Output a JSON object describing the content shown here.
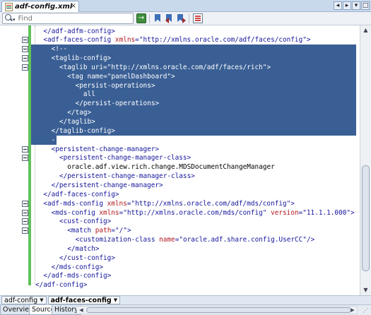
{
  "tabs": [
    {
      "label": "adf-config.xml",
      "close": "×"
    }
  ],
  "window_buttons": [
    "◂",
    "▸",
    "▾",
    "□"
  ],
  "toolbar": {
    "search_placeholder": "Find"
  },
  "code_lines": [
    {
      "fold": false,
      "selected": false,
      "indent": 2,
      "parts": [
        {
          "c": "t-tag",
          "t": "</adf-adfm-config>"
        }
      ]
    },
    {
      "fold": true,
      "selected": false,
      "indent": 2,
      "parts": [
        {
          "c": "t-tag",
          "t": "<adf-faces-config "
        },
        {
          "c": "t-attr",
          "t": "xmlns"
        },
        {
          "c": "t-tag",
          "t": "="
        },
        {
          "c": "t-val",
          "t": "\"http://xmlns.oracle.com/adf/faces/config\""
        },
        {
          "c": "t-tag",
          "t": ">"
        }
      ]
    },
    {
      "fold": true,
      "selected": true,
      "indent": 4,
      "parts": [
        {
          "c": "t-txt",
          "t": "<!--"
        }
      ]
    },
    {
      "fold": true,
      "selected": true,
      "indent": 4,
      "parts": [
        {
          "c": "t-txt",
          "t": "<taglib-config>"
        }
      ]
    },
    {
      "fold": true,
      "selected": true,
      "indent": 6,
      "parts": [
        {
          "c": "t-txt",
          "t": "<taglib uri=\"http://xmlns.oracle.com/adf/faces/rich\">"
        }
      ]
    },
    {
      "fold": false,
      "selected": true,
      "indent": 8,
      "parts": [
        {
          "c": "t-txt",
          "t": "<tag name=\"panelDashboard\">"
        }
      ]
    },
    {
      "fold": false,
      "selected": true,
      "indent": 10,
      "parts": [
        {
          "c": "t-txt",
          "t": "<persist-operations>"
        }
      ]
    },
    {
      "fold": false,
      "selected": true,
      "indent": 12,
      "parts": [
        {
          "c": "t-txt",
          "t": "all"
        }
      ]
    },
    {
      "fold": false,
      "selected": true,
      "indent": 10,
      "parts": [
        {
          "c": "t-txt",
          "t": "</persist-operations>"
        }
      ]
    },
    {
      "fold": false,
      "selected": true,
      "indent": 8,
      "parts": [
        {
          "c": "t-txt",
          "t": "</tag>"
        }
      ]
    },
    {
      "fold": false,
      "selected": true,
      "indent": 6,
      "parts": [
        {
          "c": "t-txt",
          "t": "</taglib>"
        }
      ]
    },
    {
      "fold": false,
      "selected": true,
      "indent": 4,
      "parts": [
        {
          "c": "t-txt",
          "t": "</taglib-config>"
        }
      ]
    },
    {
      "fold": false,
      "selected": true,
      "last": true,
      "indent": 4,
      "parts": [
        {
          "c": "t-txt",
          "t": "-->"
        }
      ]
    },
    {
      "fold": true,
      "selected": false,
      "indent": 4,
      "parts": [
        {
          "c": "t-tag",
          "t": "<persistent-change-manager>"
        }
      ]
    },
    {
      "fold": true,
      "selected": false,
      "indent": 6,
      "parts": [
        {
          "c": "t-tag",
          "t": "<persistent-change-manager-class>"
        }
      ]
    },
    {
      "fold": false,
      "selected": false,
      "indent": 8,
      "parts": [
        {
          "c": "t-txt",
          "t": "oracle.adf.view.rich.change.MDSDocumentChangeManager"
        }
      ]
    },
    {
      "fold": false,
      "selected": false,
      "indent": 6,
      "parts": [
        {
          "c": "t-tag",
          "t": "</persistent-change-manager-class>"
        }
      ]
    },
    {
      "fold": false,
      "selected": false,
      "indent": 4,
      "parts": [
        {
          "c": "t-tag",
          "t": "</persistent-change-manager>"
        }
      ]
    },
    {
      "fold": false,
      "selected": false,
      "indent": 2,
      "parts": [
        {
          "c": "t-tag",
          "t": "</adf-faces-config>"
        }
      ]
    },
    {
      "fold": true,
      "selected": false,
      "indent": 2,
      "parts": [
        {
          "c": "t-tag",
          "t": "<adf-mds-config "
        },
        {
          "c": "t-attr",
          "t": "xmlns"
        },
        {
          "c": "t-tag",
          "t": "="
        },
        {
          "c": "t-val",
          "t": "\"http://xmlns.oracle.com/adf/mds/config\""
        },
        {
          "c": "t-tag",
          "t": ">"
        }
      ]
    },
    {
      "fold": true,
      "selected": false,
      "indent": 4,
      "parts": [
        {
          "c": "t-tag",
          "t": "<mds-config "
        },
        {
          "c": "t-attr",
          "t": "xmlns"
        },
        {
          "c": "t-tag",
          "t": "="
        },
        {
          "c": "t-val",
          "t": "\"http://xmlns.oracle.com/mds/config\" "
        },
        {
          "c": "t-attr",
          "t": "version"
        },
        {
          "c": "t-tag",
          "t": "="
        },
        {
          "c": "t-val",
          "t": "\"11.1.1.000\""
        },
        {
          "c": "t-tag",
          "t": ">"
        }
      ]
    },
    {
      "fold": true,
      "selected": false,
      "indent": 6,
      "parts": [
        {
          "c": "t-tag",
          "t": "<cust-config>"
        }
      ]
    },
    {
      "fold": true,
      "selected": false,
      "indent": 8,
      "parts": [
        {
          "c": "t-tag",
          "t": "<match "
        },
        {
          "c": "t-attr",
          "t": "path"
        },
        {
          "c": "t-tag",
          "t": "="
        },
        {
          "c": "t-val",
          "t": "\"/\""
        },
        {
          "c": "t-tag",
          "t": ">"
        }
      ]
    },
    {
      "fold": false,
      "selected": false,
      "indent": 10,
      "parts": [
        {
          "c": "t-tag",
          "t": "<customization-class "
        },
        {
          "c": "t-attr",
          "t": "name"
        },
        {
          "c": "t-tag",
          "t": "="
        },
        {
          "c": "t-val",
          "t": "\"oracle.adf.share.config.UserCC\""
        },
        {
          "c": "t-tag",
          "t": "/>"
        }
      ]
    },
    {
      "fold": false,
      "selected": false,
      "indent": 8,
      "parts": [
        {
          "c": "t-tag",
          "t": "</match>"
        }
      ]
    },
    {
      "fold": false,
      "selected": false,
      "indent": 6,
      "parts": [
        {
          "c": "t-tag",
          "t": "</cust-config>"
        }
      ]
    },
    {
      "fold": false,
      "selected": false,
      "indent": 4,
      "parts": [
        {
          "c": "t-tag",
          "t": "</mds-config>"
        }
      ]
    },
    {
      "fold": false,
      "selected": false,
      "indent": 2,
      "parts": [
        {
          "c": "t-tag",
          "t": "</adf-mds-config>"
        }
      ]
    },
    {
      "fold": false,
      "selected": false,
      "indent": 0,
      "parts": [
        {
          "c": "t-tag",
          "t": "</adf-config>"
        }
      ]
    }
  ],
  "breadcrumbs": [
    {
      "label": "adf-config",
      "active": false
    },
    {
      "label": "adf-faces-config",
      "active": true
    }
  ],
  "bottom_tabs": [
    {
      "label": "Overview",
      "active": false
    },
    {
      "label": "Source",
      "active": true
    },
    {
      "label": "History",
      "active": false
    }
  ]
}
